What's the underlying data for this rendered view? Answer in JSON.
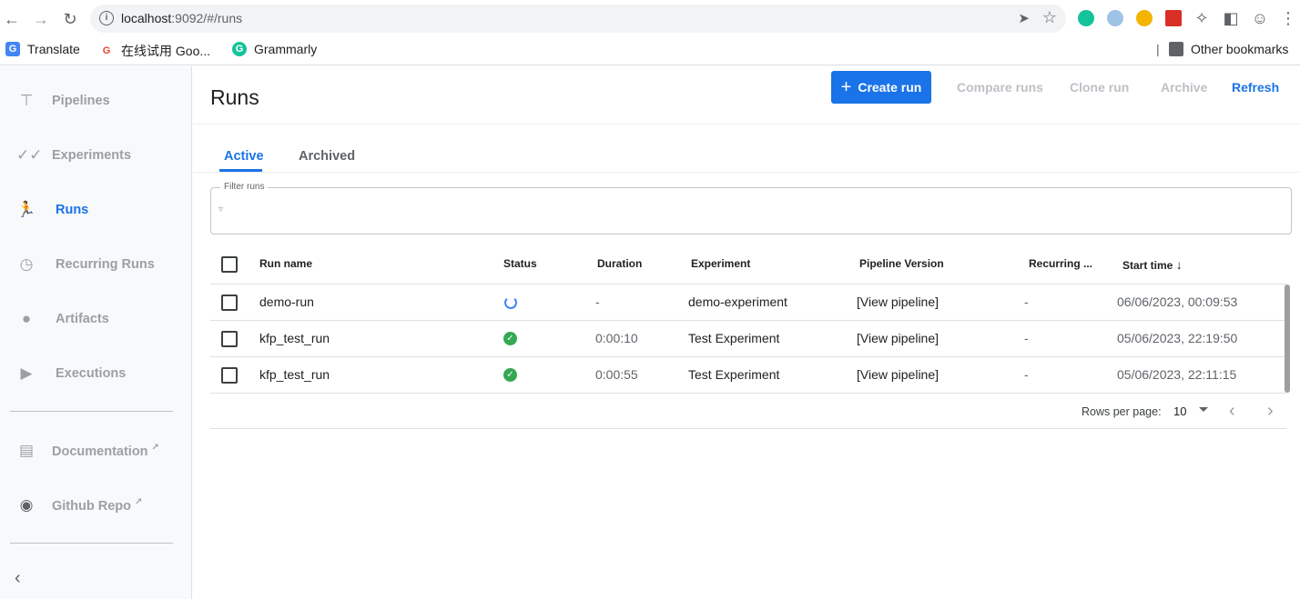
{
  "browser": {
    "url_host": "localhost",
    "url_rest": ":9092/#/runs",
    "info_icon": "info-icon",
    "bookmarks": [
      {
        "label": "Translate",
        "icon": "translate-icon"
      },
      {
        "label": "在线试用 Goo...",
        "icon": "google-icon"
      },
      {
        "label": "Grammarly",
        "icon": "grammarly-icon"
      }
    ],
    "other_bookmarks": "Other bookmarks"
  },
  "sidebar": {
    "items": [
      {
        "label": "Pipelines",
        "icon": "pipelines-icon",
        "active": false
      },
      {
        "label": "Experiments",
        "icon": "experiments-icon",
        "active": false
      },
      {
        "label": "Runs",
        "icon": "runs-icon",
        "active": true
      },
      {
        "label": "Recurring Runs",
        "icon": "alarm-icon",
        "active": false
      },
      {
        "label": "Artifacts",
        "icon": "artifacts-icon",
        "active": false
      },
      {
        "label": "Executions",
        "icon": "play-icon",
        "active": false
      }
    ],
    "links": [
      {
        "label": "Documentation",
        "icon": "document-icon"
      },
      {
        "label": "Github Repo",
        "icon": "github-icon"
      }
    ]
  },
  "header": {
    "title": "Runs",
    "create_label": "Create run",
    "compare_label": "Compare runs",
    "clone_label": "Clone run",
    "archive_label": "Archive",
    "refresh_label": "Refresh"
  },
  "tabs": [
    {
      "label": "Active",
      "active": true
    },
    {
      "label": "Archived",
      "active": false
    }
  ],
  "filter": {
    "label": "Filter runs",
    "value": ""
  },
  "table": {
    "columns": [
      "Run name",
      "Status",
      "Duration",
      "Experiment",
      "Pipeline Version",
      "Recurring ...",
      "Start time"
    ],
    "rows": [
      {
        "name": "demo-run",
        "status": "running",
        "duration": "-",
        "experiment": "demo-experiment",
        "pipeline": "[View pipeline]",
        "recurring": "-",
        "start": "06/06/2023, 00:09:53"
      },
      {
        "name": "kfp_test_run",
        "status": "succeeded",
        "duration": "0:00:10",
        "experiment": "Test Experiment",
        "pipeline": "[View pipeline]",
        "recurring": "-",
        "start": "05/06/2023, 22:19:50"
      },
      {
        "name": "kfp_test_run",
        "status": "succeeded",
        "duration": "0:00:55",
        "experiment": "Test Experiment",
        "pipeline": "[View pipeline]",
        "recurring": "-",
        "start": "05/06/2023, 22:11:15"
      }
    ]
  },
  "pagination": {
    "label": "Rows per page:",
    "value": "10"
  },
  "colors": {
    "accent": "#1a73e8",
    "success": "#34a853",
    "running": "#4285f4"
  }
}
